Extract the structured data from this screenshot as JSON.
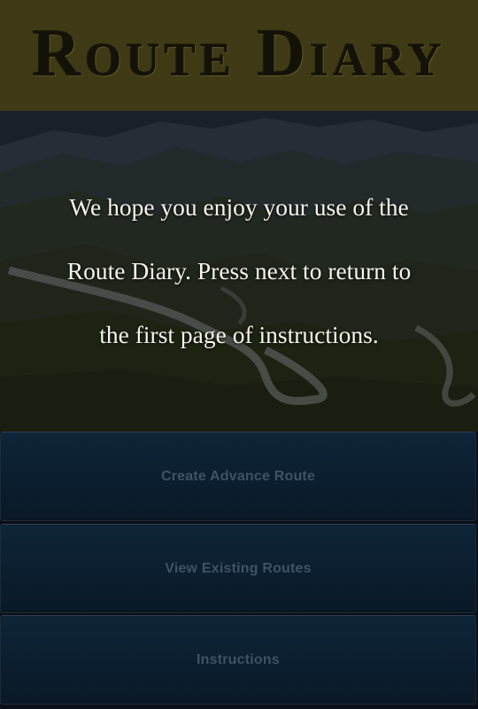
{
  "header": {
    "logo_text": "Route Diary"
  },
  "hero": {
    "message": "We hope you enjoy your use of  the\nRoute Diary.  Press next to return to\nthe first page of  instructions."
  },
  "menu": {
    "buttons": [
      {
        "label": "Create Advance Route"
      },
      {
        "label": "View Existing Routes"
      },
      {
        "label": "Instructions"
      }
    ]
  },
  "colors": {
    "header_bg": "#3f3a16",
    "logo": "#141208",
    "button_bg": "#0b1e2f",
    "button_text": "#3f5264",
    "message_text": "#f6f3ea"
  }
}
